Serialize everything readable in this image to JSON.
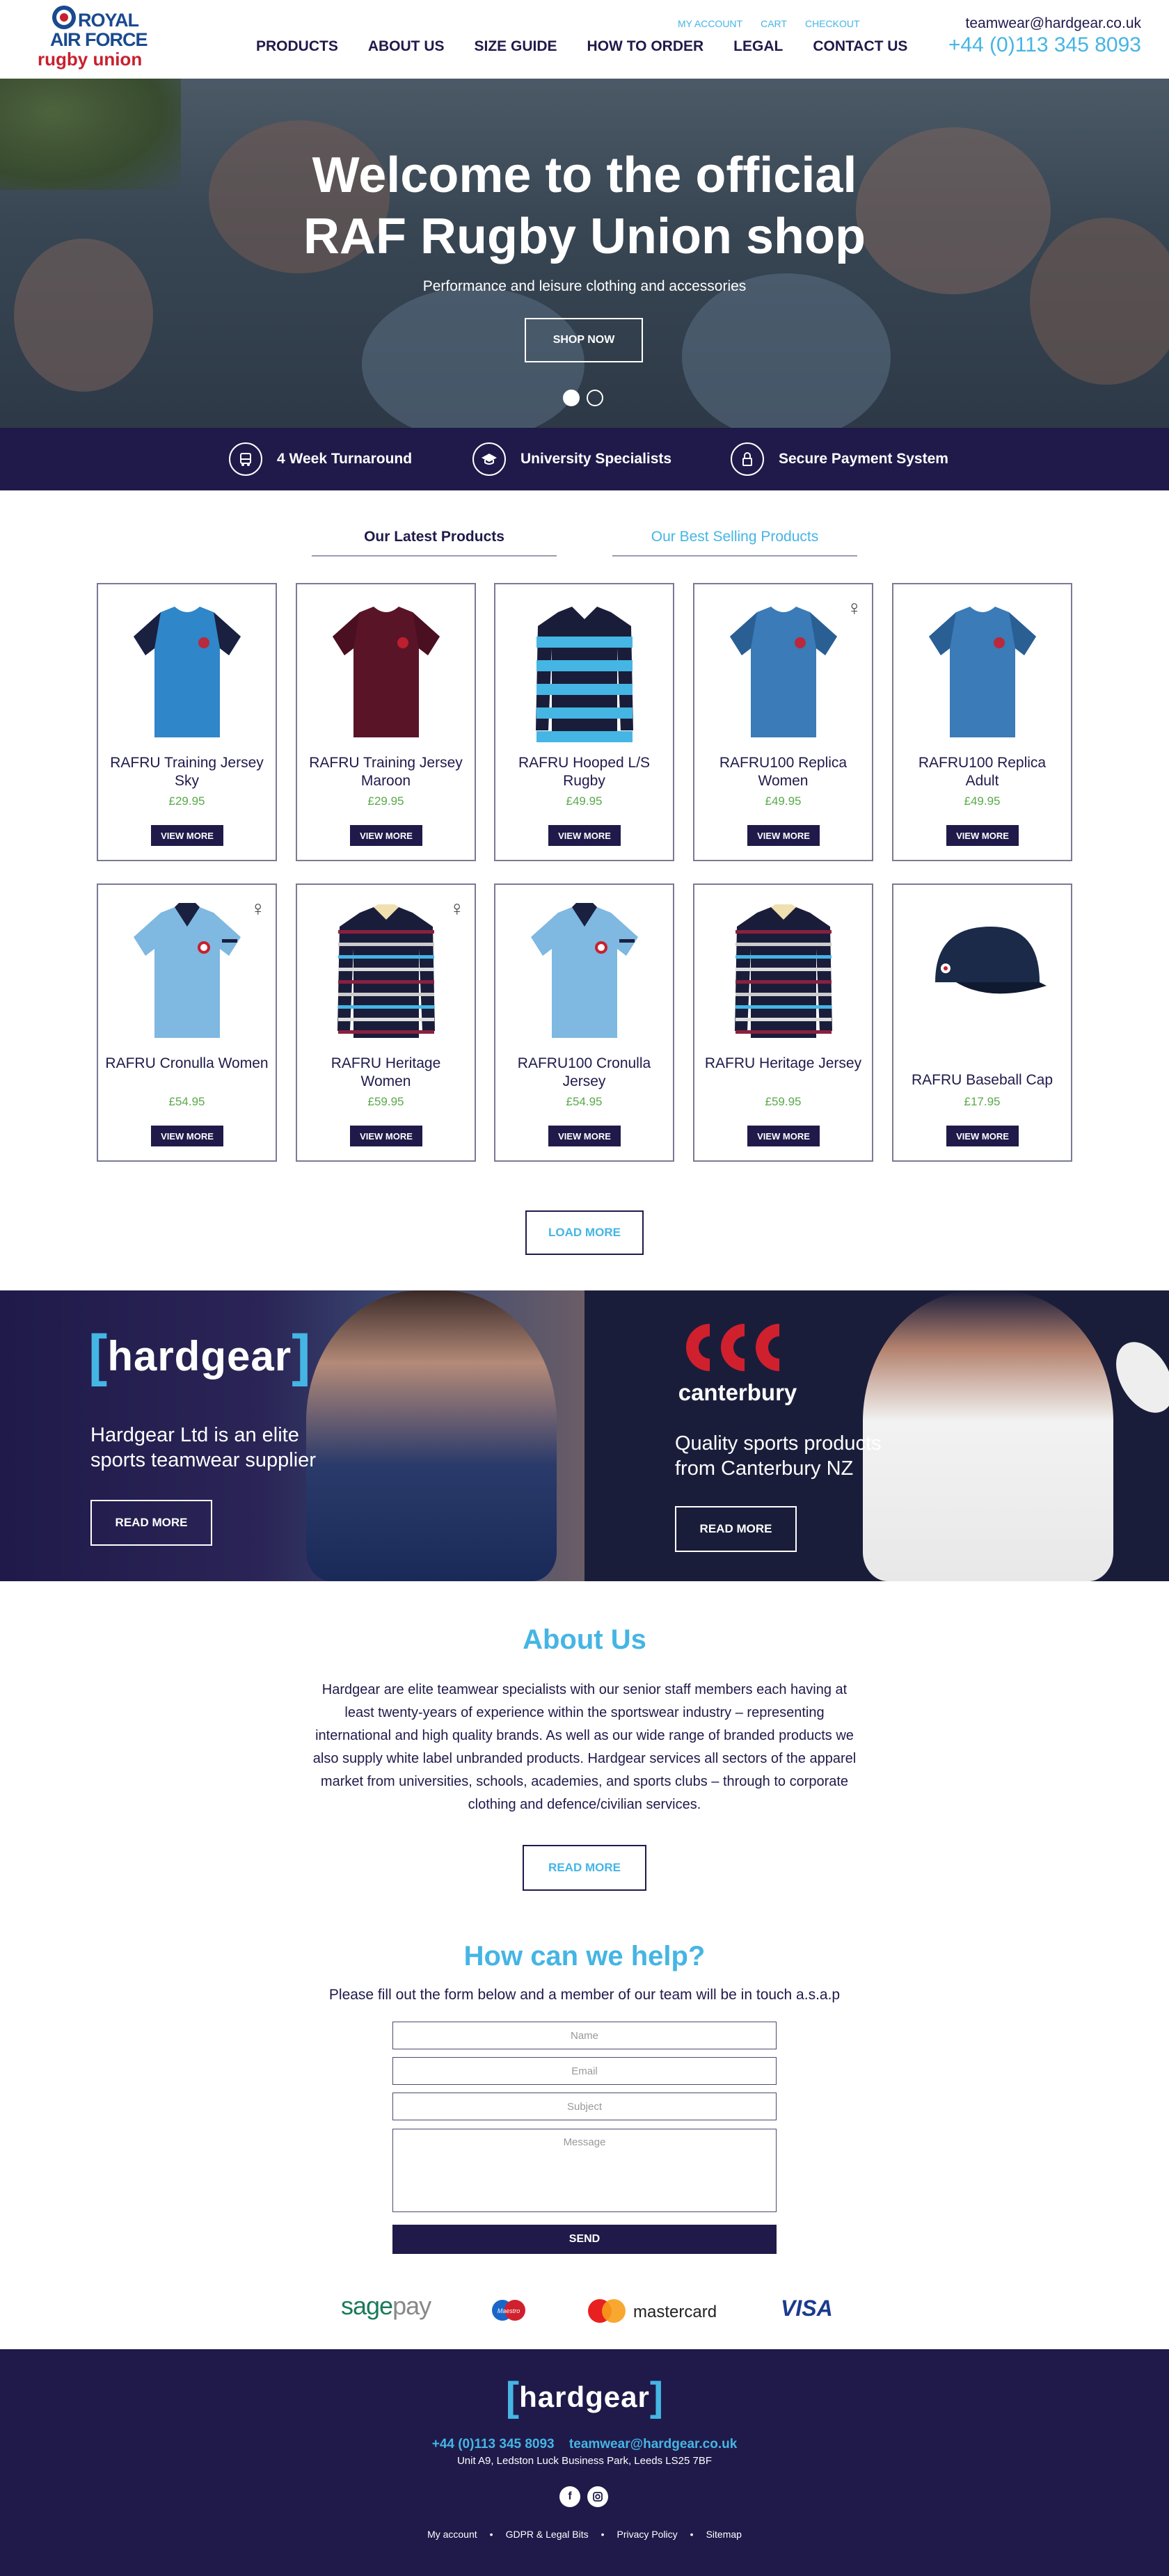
{
  "header": {
    "logo": {
      "line1": "ROYAL",
      "line2": "AIR FORCE",
      "line3": "rugby union"
    },
    "nav": [
      "PRODUCTS",
      "ABOUT US",
      "SIZE GUIDE",
      "HOW TO ORDER",
      "LEGAL",
      "CONTACT US"
    ],
    "util_links": [
      "MY ACCOUNT",
      "CART",
      "CHECKOUT"
    ],
    "email": "teamwear@hardgear.co.uk",
    "phone": "+44 (0)113 345 8093"
  },
  "hero": {
    "title_line1": "Welcome to the official",
    "title_line2": "RAF Rugby Union shop",
    "subtitle": "Performance and leisure clothing and accessories",
    "button": "SHOP NOW"
  },
  "features": [
    {
      "icon": "truck-icon",
      "label": "4 Week Turnaround"
    },
    {
      "icon": "graduation-cap-icon",
      "label": "University Specialists"
    },
    {
      "icon": "lock-icon",
      "label": "Secure Payment System"
    }
  ],
  "tabs": [
    "Our Latest Products",
    "Our Best Selling Products"
  ],
  "products": [
    {
      "name": "RAFRU Training Jersey Sky",
      "price": "£29.95",
      "button": "VIEW MORE",
      "female": false,
      "shirt_color": "#2f86c9",
      "accent": "#1a2040",
      "type": "tee"
    },
    {
      "name": "RAFRU Training Jersey Maroon",
      "price": "£29.95",
      "button": "VIEW MORE",
      "female": false,
      "shirt_color": "#5a1428",
      "accent": "#4a0f20",
      "type": "tee"
    },
    {
      "name": "RAFRU Hooped L/S Rugby",
      "price": "£49.95",
      "button": "VIEW MORE",
      "female": false,
      "shirt_color": "#1a1d3a",
      "accent": "#45b5e4",
      "type": "hooped"
    },
    {
      "name": "RAFRU100 Replica Women",
      "price": "£49.95",
      "button": "VIEW MORE",
      "female": true,
      "shirt_color": "#3a7bb8",
      "accent": "#2a5f94",
      "type": "tee"
    },
    {
      "name": "RAFRU100 Replica Adult",
      "price": "£49.95",
      "button": "VIEW MORE",
      "female": false,
      "shirt_color": "#3a7bb8",
      "accent": "#2a5f94",
      "type": "tee"
    },
    {
      "name": "RAFRU Cronulla Women",
      "price": "£54.95",
      "button": "VIEW MORE",
      "female": true,
      "shirt_color": "#7fb8e0",
      "accent": "#1a2040",
      "type": "polo"
    },
    {
      "name": "RAFRU Heritage Women",
      "price": "£59.95",
      "button": "VIEW MORE",
      "female": true,
      "shirt_color": "#1a1d3a",
      "accent": "#8a2040",
      "type": "heritage"
    },
    {
      "name": "RAFRU100 Cronulla Jersey",
      "price": "£54.95",
      "button": "VIEW MORE",
      "female": false,
      "shirt_color": "#7fb8e0",
      "accent": "#1a2040",
      "type": "polo"
    },
    {
      "name": "RAFRU Heritage Jersey",
      "price": "£59.95",
      "button": "VIEW MORE",
      "female": false,
      "shirt_color": "#1a1d3a",
      "accent": "#8a2040",
      "type": "heritage"
    },
    {
      "name": "RAFRU Baseball Cap",
      "price": "£17.95",
      "button": "VIEW MORE",
      "female": false,
      "shirt_color": "#1a2a48",
      "accent": "#0f1a30",
      "type": "cap"
    }
  ],
  "load_more": "LOAD MORE",
  "banners": {
    "hardgear": {
      "brand": "hardgear",
      "text": "Hardgear Ltd is an elite sports teamwear supplier",
      "button": "READ MORE"
    },
    "canterbury": {
      "brand": "canterbury",
      "text": "Quality sports products from Canterbury NZ",
      "button": "READ MORE"
    }
  },
  "about": {
    "title": "About Us",
    "text": "Hardgear are elite teamwear specialists with our senior staff members each having at least twenty-years of experience within the sportswear industry – representing international and high quality brands. As well as our wide range of branded products we also supply white label unbranded products. Hardgear services all sectors of the apparel market from universities, schools, academies, and sports clubs – through to corporate clothing and defence/civilian services.",
    "button": "READ MORE"
  },
  "help": {
    "title": "How can we help?",
    "subtitle": "Please fill out the form below and a member of our team will be in touch a.s.a.p",
    "placeholders": {
      "name": "Name",
      "email": "Email",
      "subject": "Subject",
      "message": "Message"
    },
    "send": "SEND"
  },
  "payments": {
    "sagepay_a": "sage",
    "sagepay_b": "pay",
    "maestro": "Maestro",
    "mastercard": "mastercard",
    "visa": "VISA"
  },
  "footer": {
    "brand": "hardgear",
    "phone": "+44 (0)113 345 8093",
    "email": "teamwear@hardgear.co.uk",
    "address": "Unit A9, Ledston Luck Business Park, Leeds LS25 7BF",
    "links": [
      "My account",
      "GDPR & Legal Bits",
      "Privacy Policy",
      "Sitemap"
    ],
    "social": [
      "facebook-icon",
      "instagram-icon"
    ]
  },
  "colors": {
    "navy": "#1f1a4a",
    "accent_blue": "#45b5e4",
    "price_green": "#5aa94a",
    "raf_red": "#c8202e"
  }
}
